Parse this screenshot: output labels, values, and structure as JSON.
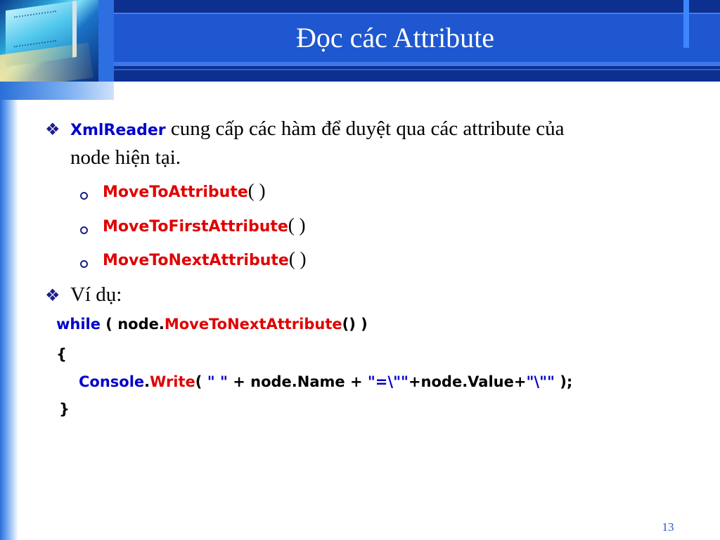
{
  "slide": {
    "title": "Đọc các Attribute",
    "page_number": "13"
  },
  "bullets": {
    "symbol": "❖",
    "intro_keyword": "XmlReader",
    "intro_text_line1": " cung cấp các hàm để duyệt qua các attribute của",
    "intro_text_line2": "node hiện tại.",
    "methods": [
      {
        "name": "MoveToAttribute",
        "suffix": "( )"
      },
      {
        "name": "MoveToFirstAttribute",
        "suffix": "( )"
      },
      {
        "name": "MoveToNextAttribute",
        "suffix": "( )"
      }
    ],
    "example_label": "Ví dụ:"
  },
  "code": {
    "line1": {
      "kw": "while",
      "a": " ( node.",
      "method": "MoveToNextAttribute",
      "b": "() )"
    },
    "line2": "{",
    "line3": {
      "obj": "Console",
      "dot": ".",
      "method": "Write",
      "a": "( ",
      "s1": "\" \"",
      "b": " + node.Name + ",
      "s2": "\"=\\\"\"",
      "c": "+node.Value+",
      "s3": "\"\\\"\"",
      "d": " );"
    },
    "line4": "}"
  },
  "colors": {
    "header": "#0d2f8f",
    "title_bar": "#1f57d0",
    "keyword_blue": "#0000cc",
    "keyword_red": "#e00000"
  }
}
